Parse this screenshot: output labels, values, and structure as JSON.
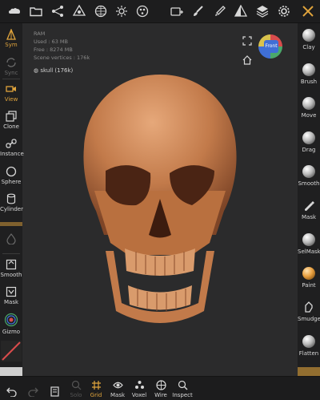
{
  "colors": {
    "accent": "#e0a43c",
    "background": "#2b2b2c",
    "toolbar": "#1f1f20",
    "skull": "#c98052"
  },
  "topbar": {
    "icons": [
      "cloud-icon",
      "folder-icon",
      "share-nodes-icon",
      "scene-icon",
      "sphere-grid-icon",
      "sun-icon",
      "material-icon",
      "camera-add-icon",
      "brush-icon",
      "paint-drop-icon",
      "contrast-icon",
      "layers-icon",
      "settings-icon",
      "tools-icon"
    ]
  },
  "stats": {
    "ram": "RAM",
    "used": "Used : 63 MB",
    "free": "Free : 8274 MB",
    "scene_vertices": "Scene vertices : 176k"
  },
  "mesh": {
    "name": "skull (176k)"
  },
  "gizmo": {
    "label": "Front"
  },
  "left_tools": [
    {
      "name": "sym",
      "label": "Sym",
      "state": "active"
    },
    {
      "name": "sync",
      "label": "Sync",
      "state": "dim"
    },
    {
      "name": "view",
      "label": "View",
      "state": "active"
    },
    {
      "name": "clone",
      "label": "Clone",
      "state": "normal"
    },
    {
      "name": "instance",
      "label": "Instance",
      "state": "normal"
    },
    {
      "name": "sphere",
      "label": "Sphere",
      "state": "normal"
    },
    {
      "name": "cylinder",
      "label": "Cylinder",
      "state": "normal"
    },
    {
      "name": "smooth",
      "label": "Smooth",
      "state": "normal"
    },
    {
      "name": "mask",
      "label": "Mask",
      "state": "normal"
    },
    {
      "name": "gizmo",
      "label": "Gizmo",
      "state": "normal"
    }
  ],
  "right_tools": [
    {
      "name": "clay",
      "label": "Clay"
    },
    {
      "name": "brush",
      "label": "Brush"
    },
    {
      "name": "move",
      "label": "Move"
    },
    {
      "name": "drag",
      "label": "Drag"
    },
    {
      "name": "smooth",
      "label": "Smooth"
    },
    {
      "name": "mask",
      "label": "Mask"
    },
    {
      "name": "selmask",
      "label": "SelMask"
    },
    {
      "name": "paint",
      "label": "Paint"
    },
    {
      "name": "smudge",
      "label": "Smudge"
    },
    {
      "name": "flatten",
      "label": "Flatten"
    }
  ],
  "bottom_tools": [
    {
      "name": "undo",
      "label": "",
      "state": "normal"
    },
    {
      "name": "redo",
      "label": "",
      "state": "dim"
    },
    {
      "name": "scene",
      "label": "",
      "state": "normal"
    },
    {
      "name": "solo",
      "label": "Solo",
      "state": "dim"
    },
    {
      "name": "grid",
      "label": "Grid",
      "state": "active"
    },
    {
      "name": "mask",
      "label": "Mask",
      "state": "normal"
    },
    {
      "name": "voxel",
      "label": "Voxel",
      "state": "normal"
    },
    {
      "name": "wire",
      "label": "Wire",
      "state": "normal"
    },
    {
      "name": "inspect",
      "label": "Inspect",
      "state": "normal"
    }
  ]
}
